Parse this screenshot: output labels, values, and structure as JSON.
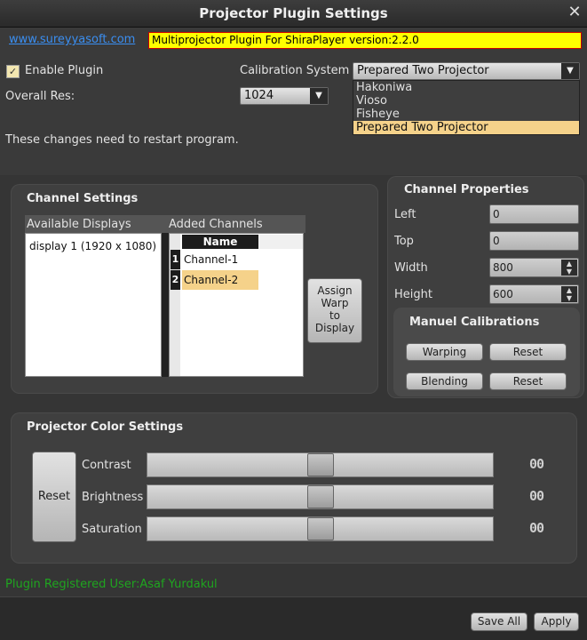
{
  "window": {
    "title": "Projector Plugin Settings",
    "close": "✕"
  },
  "header": {
    "link": "www.sureyyasoft.com",
    "version": "Multiprojector Plugin For ShiraPlayer version:2.2.0"
  },
  "general": {
    "enable_plugin": {
      "label": "Enable Plugin",
      "checked": true,
      "mark": "✓"
    },
    "calibration": {
      "label": "Calibration System",
      "selected": "Prepared Two Projector",
      "options": [
        "Hakoniwa",
        "Vioso",
        "Fisheye",
        "Prepared Two Projector"
      ]
    },
    "overall_res": {
      "label": "Overall Res:",
      "value": "1024"
    },
    "restart_note": "These changes need to restart program."
  },
  "channel_settings": {
    "title": "Channel Settings",
    "available_displays_label": "Available Displays",
    "available_displays": [
      "display 1 (1920 x 1080)"
    ],
    "added_channels_label": "Added Channels",
    "added_channels_header": "Name",
    "added_channels": [
      {
        "index": "1",
        "name": "Channel-1"
      },
      {
        "index": "2",
        "name": "Channel-2"
      }
    ],
    "assign_button": [
      "Assign",
      "Warp",
      "to",
      "Display"
    ]
  },
  "channel_properties": {
    "title": "Channel Properties",
    "fields": [
      {
        "label": "Left",
        "value": "0"
      },
      {
        "label": "Top",
        "value": "0"
      },
      {
        "label": "Width",
        "value": "800"
      },
      {
        "label": "Height",
        "value": "600"
      }
    ]
  },
  "manual_calibrations": {
    "title": "Manuel Calibrations",
    "warping": "Warping",
    "blending": "Blending",
    "reset1": "Reset",
    "reset2": "Reset"
  },
  "color_settings": {
    "title": "Projector Color Settings",
    "reset": "Reset",
    "sliders": [
      {
        "label": "Contrast",
        "readout": "00"
      },
      {
        "label": "Brightness",
        "readout": "00"
      },
      {
        "label": "Saturation",
        "readout": "00"
      }
    ]
  },
  "footer": {
    "registered_user": "Plugin Registered User:Asaf Yurdakul",
    "save_all": "Save All",
    "apply": "Apply"
  },
  "colors": {
    "highlight": "#f5d28a",
    "version_bg": "#ffff00",
    "link": "#3a8ef0",
    "registered": "#1fa51f"
  }
}
